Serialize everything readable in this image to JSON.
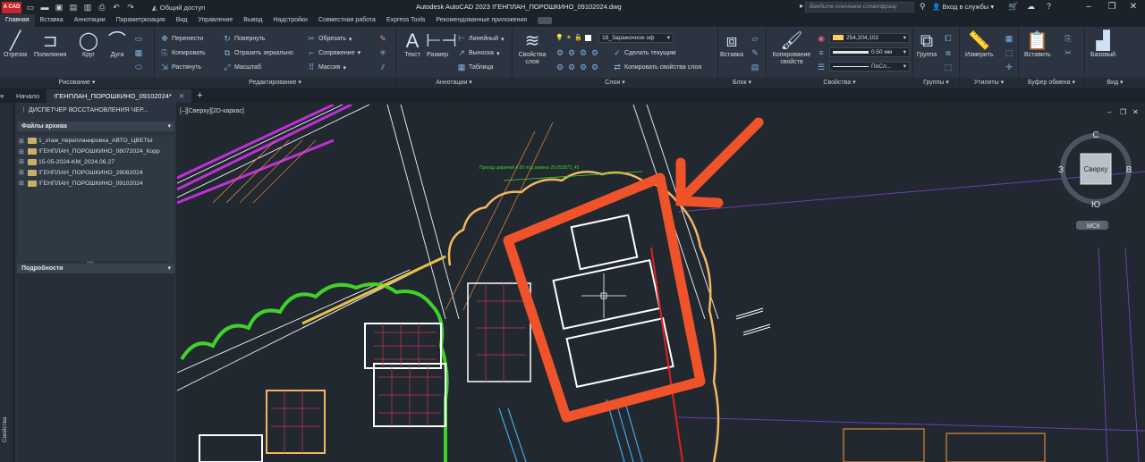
{
  "titlebar": {
    "app_logo": "A CAD",
    "share": "Общий доступ",
    "title": "Autodesk AutoCAD 2023   !ГЕНПЛАН_ПОРОШКИНО_09102024.dwg",
    "search_placeholder": "Введите ключевое слово/фразу",
    "account": "Вход в службы"
  },
  "ribbon_tabs": [
    "Главная",
    "Вставка",
    "Аннотации",
    "Параметризация",
    "Вид",
    "Управление",
    "Вывод",
    "Надстройки",
    "Совместная работа",
    "Express Tools",
    "Рекомендованные приложения"
  ],
  "ribbon": {
    "draw": {
      "title": "Рисование",
      "line": "Отрезок",
      "polyline": "Полилиния",
      "circle": "Круг",
      "arc": "Дуга"
    },
    "modify": {
      "title": "Редактирование",
      "move": "Перенести",
      "rotate": "Повернуть",
      "trim": "Обрезать",
      "copy": "Копировать",
      "mirror": "Отразить зеркально",
      "fillet": "Сопряжение",
      "stretch": "Растянуть",
      "scale": "Масштаб",
      "array": "Массив"
    },
    "annotation": {
      "title": "Аннотации",
      "text": "Текст",
      "dimension": "Размер",
      "linear": "Линейный",
      "leader": "Выноска",
      "table": "Таблица"
    },
    "layers": {
      "title": "Слои",
      "properties": "Свойства слоя",
      "current_layer": "18_Заражочное оф",
      "make_current": "Сделать текущим",
      "match_layer": "Копировать свойства слоя"
    },
    "block": {
      "title": "Блок",
      "insert": "Вставка"
    },
    "properties": {
      "title": "Свойства",
      "match": "Копирование свойств",
      "color": "254,204,102",
      "lineweight": "0.50 мм",
      "linetype": "ПоСл..."
    },
    "groups": {
      "title": "Группы",
      "group": "Группа"
    },
    "utilities": {
      "title": "Утилиты",
      "measure": "Измерить"
    },
    "clipboard": {
      "title": "Буфер обмена",
      "paste": "Вставить"
    },
    "view": {
      "title": "Вид",
      "base": "Базовый"
    }
  },
  "file_tabs": {
    "start": "Начало",
    "active": "!ГЕНПЛАН_ПОРОШКИНО_09102024*"
  },
  "palette": {
    "title": "ДИСПЕТЧЕР ВОССТАНОВЛЕНИЯ ЧЕР...",
    "files_header": "Файлы архива",
    "files": [
      "1_этаж_перепланировка_АВТО_ЦВЕТЫ",
      "!ГЕНПЛАН_ПОРОШКИНО_08072024_Корр",
      "15-05-2024-KM_2024.06.27",
      "!ГЕНПЛАН_ПОРОШКИНО_28082024",
      "!ГЕНПЛАН_ПОРОШКИНО_09102024"
    ],
    "details_header": "Подробности",
    "side_label": "Свойства"
  },
  "drawing": {
    "view_label": "[–][Сверху][2D-каркас]",
    "viewcube": {
      "north": "С",
      "south": "Ю",
      "west": "З",
      "east": "В",
      "face": "Сверху",
      "wcs": "МСК"
    },
    "annotation": "Проезд шириной 4,00 под замена 29.053573_45"
  },
  "colors": {
    "background": "#212830",
    "ribbon": "#2b3440",
    "accent_arrow": "#f0522a",
    "cloud_green": "#40d22a",
    "cloud_orange": "#f2b860",
    "magenta": "#c030d8"
  }
}
